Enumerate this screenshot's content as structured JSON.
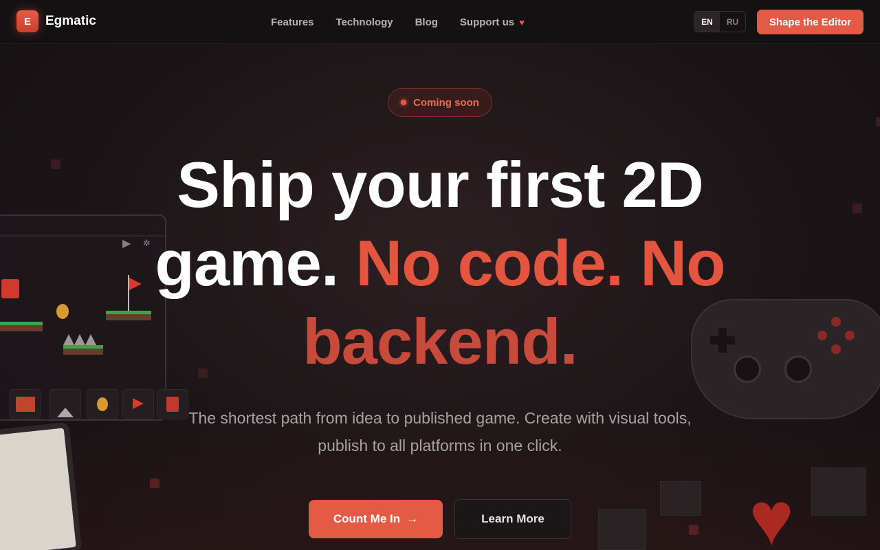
{
  "nav": {
    "brand_mark": "E",
    "brand_name": "Egmatic",
    "links": [
      {
        "label": "Features"
      },
      {
        "label": "Technology"
      },
      {
        "label": "Blog"
      },
      {
        "label": "Support us",
        "icon": "heart-icon"
      }
    ],
    "lang": {
      "active": "EN",
      "inactive": "RU"
    },
    "cta_label": "Shape the Editor"
  },
  "hero": {
    "badge": "Coming soon",
    "headline": {
      "line1": "Ship your first 2D",
      "line2_white": "game.",
      "line2_accent": "No code. No",
      "line3_accent": "backend."
    },
    "subtitle": "The shortest path from idea to published game. Create with visual tools, publish to all platforms in one click.",
    "primary_button": "Count Me In",
    "primary_arrow": "→",
    "secondary_button": "Learn More"
  },
  "colors": {
    "accent": "#e55a45",
    "background": "#1a1416",
    "nav_bg": "#141112"
  }
}
